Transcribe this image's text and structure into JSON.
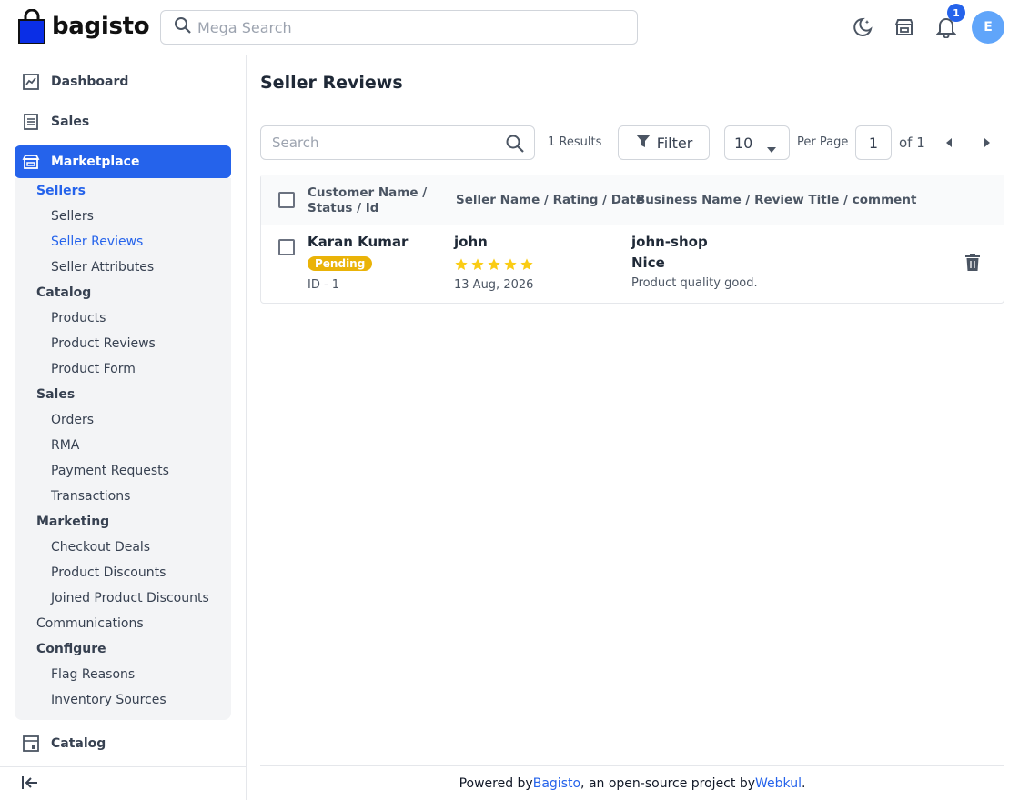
{
  "header": {
    "logo_text": "bagisto",
    "search_placeholder": "Mega Search",
    "notification_count": "1",
    "avatar_initial": "E"
  },
  "sidebar": {
    "dashboard": "Dashboard",
    "sales": "Sales",
    "marketplace": "Marketplace",
    "catalog": "Catalog",
    "submenu": {
      "sellers_group": "Sellers",
      "sellers": "Sellers",
      "seller_reviews": "Seller Reviews",
      "seller_attributes": "Seller Attributes",
      "catalog_group": "Catalog",
      "products": "Products",
      "product_reviews": "Product Reviews",
      "product_form": "Product Form",
      "sales_group": "Sales",
      "orders": "Orders",
      "rma": "RMA",
      "payment_requests": "Payment Requests",
      "transactions": "Transactions",
      "marketing_group": "Marketing",
      "checkout_deals": "Checkout Deals",
      "product_discounts": "Product Discounts",
      "joined_product_discounts": "Joined Product Discounts",
      "communications": "Communications",
      "configure_group": "Configure",
      "flag_reasons": "Flag Reasons",
      "inventory_sources": "Inventory Sources"
    }
  },
  "main": {
    "title": "Seller Reviews",
    "search_placeholder": "Search",
    "results": "1 Results",
    "filter_label": "Filter",
    "per_page_value": "10",
    "per_page_label": "Per Page",
    "page_value": "1",
    "of_label": "of 1",
    "columns": {
      "col1_line1": "Customer Name /",
      "col1_line2": "Status / Id",
      "col2": "Seller Name / Rating / Date",
      "col3": "Business Name / Review Title / comment"
    },
    "rows": [
      {
        "customer_name": "Karan Kumar",
        "status": "Pending",
        "id": "ID - 1",
        "seller_name": "john",
        "rating": 5,
        "date": "13 Aug, 2026",
        "business_name": "john-shop",
        "review_title": "Nice",
        "comment": "Product quality good."
      }
    ]
  },
  "footer": {
    "prefix": "Powered by ",
    "link1": "Bagisto",
    "middle": ", an open-source project by ",
    "link2": "Webkul",
    "suffix": "."
  },
  "colors": {
    "accent": "#2563eb",
    "pending": "#eab308",
    "star": "#facc15"
  }
}
